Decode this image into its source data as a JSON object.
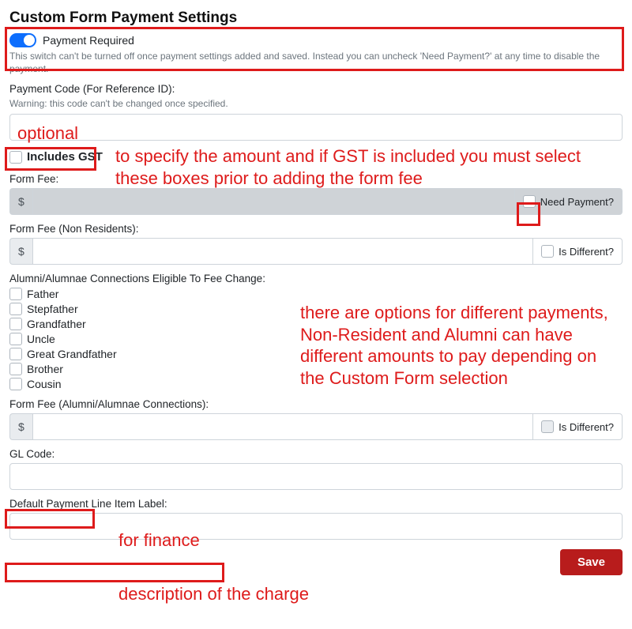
{
  "page_title": "Custom Form Payment Settings",
  "payment_required": {
    "label": "Payment Required",
    "help": "This switch can't be turned off once payment settings added and saved. Instead you can uncheck 'Need Payment?' at any time to disable the payment."
  },
  "payment_code": {
    "label": "Payment Code (For Reference ID):",
    "warning": "Warning: this code can't be changed once specified.",
    "value": ""
  },
  "includes_gst_label": "Includes GST",
  "form_fee": {
    "label": "Form Fee:",
    "currency": "$",
    "value": "",
    "need_payment_label": "Need Payment?"
  },
  "form_fee_non_res": {
    "label": "Form Fee (Non Residents):",
    "currency": "$",
    "value": "",
    "is_different_label": "Is Different?"
  },
  "connections": {
    "label": "Alumni/Alumnae Connections Eligible To Fee Change:",
    "items": [
      "Father",
      "Stepfather",
      "Grandfather",
      "Uncle",
      "Great Grandfather",
      "Brother",
      "Cousin"
    ]
  },
  "form_fee_alumni": {
    "label": "Form Fee (Alumni/Alumnae Connections):",
    "currency": "$",
    "value": "",
    "is_different_label": "Is Different?"
  },
  "gl_code": {
    "label": "GL Code:",
    "value": ""
  },
  "line_item": {
    "label": "Default Payment Line Item Label:",
    "value": ""
  },
  "save_label": "Save",
  "annotations": {
    "optional": "optional",
    "gst_note": "to specify the amount and if GST is included you must select these boxes prior to adding the form fee",
    "options_note": "there are options for different payments, Non-Resident and Alumni can have different amounts to pay depending on the Custom Form selection",
    "finance_note": "for finance",
    "charge_note": "description of the  charge"
  }
}
